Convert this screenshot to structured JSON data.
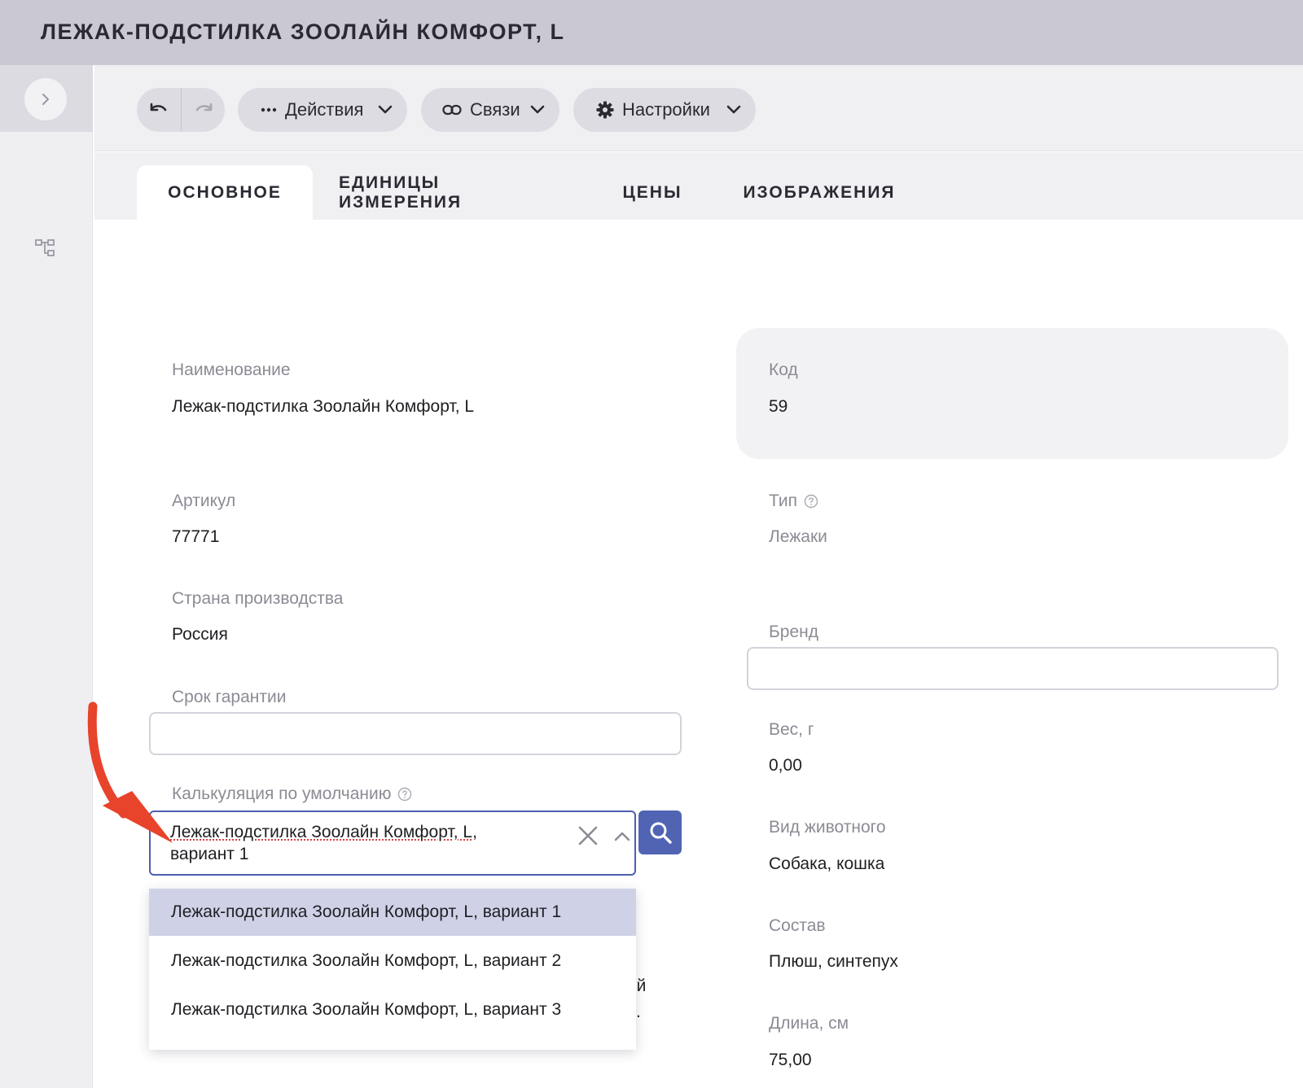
{
  "window": {
    "title": "ЛЕЖАК-ПОДСТИЛКА ЗООЛАЙН КОМФОРТ, L"
  },
  "toolbar": {
    "actions_label": "Действия",
    "links_label": "Связи",
    "settings_label": "Настройки"
  },
  "tabs": [
    {
      "label": "ОСНОВНОЕ",
      "active": true
    },
    {
      "label": "ЕДИНИЦЫ ИЗМЕРЕНИЯ",
      "active": false
    },
    {
      "label": "ЦЕНЫ",
      "active": false
    },
    {
      "label": "ИЗОБРАЖЕНИЯ",
      "active": false
    }
  ],
  "form": {
    "name": {
      "label": "Наименование",
      "value": "Лежак-подстилка Зоолайн Комфорт, L"
    },
    "code": {
      "label": "Код",
      "value": "59"
    },
    "article": {
      "label": "Артикул",
      "value": "77771"
    },
    "type": {
      "label": "Тип",
      "value": "Лежаки"
    },
    "country": {
      "label": "Страна производства",
      "value": "Россия"
    },
    "brand": {
      "label": "Бренд",
      "value": ""
    },
    "warranty": {
      "label": "Срок гарантии",
      "value": ""
    },
    "weight": {
      "label": "Вес, г",
      "value": "0,00"
    },
    "calculation": {
      "label": "Калькуляция по умолчанию",
      "value_line1": "Лежак-подстилка Зоолайн Комфорт, L,",
      "value_line2": "вариант 1",
      "options": [
        "Лежак-подстилка Зоолайн Комфорт, L, вариант 1",
        "Лежак-подстилка Зоолайн Комфорт, L, вариант 2",
        "Лежак-подстилка Зоолайн Комфорт, L, вариант 3"
      ],
      "selected_index": 0
    },
    "animal": {
      "label": "Вид животного",
      "value": "Собака, кошка"
    },
    "composition": {
      "label": "Состав",
      "value": "Плюш, синтепух"
    },
    "length": {
      "label": "Длина, см",
      "value": "75,00"
    },
    "obscured_line1": "ой",
    "obscured_line2": "ь."
  },
  "colors": {
    "titlebar": "#cac9d3",
    "accent": "#5164b4",
    "selected_option": "#cfd2e7",
    "annotation_arrow": "#e8432b"
  },
  "icons": [
    "chevron-right-icon",
    "tree-structure-icon",
    "undo-icon",
    "redo-icon",
    "more-dots-icon",
    "link-icon",
    "gear-icon",
    "chevron-down-icon",
    "help-circle-icon",
    "clear-x-icon",
    "chevron-up-icon",
    "search-icon",
    "annotation-arrow-icon"
  ]
}
